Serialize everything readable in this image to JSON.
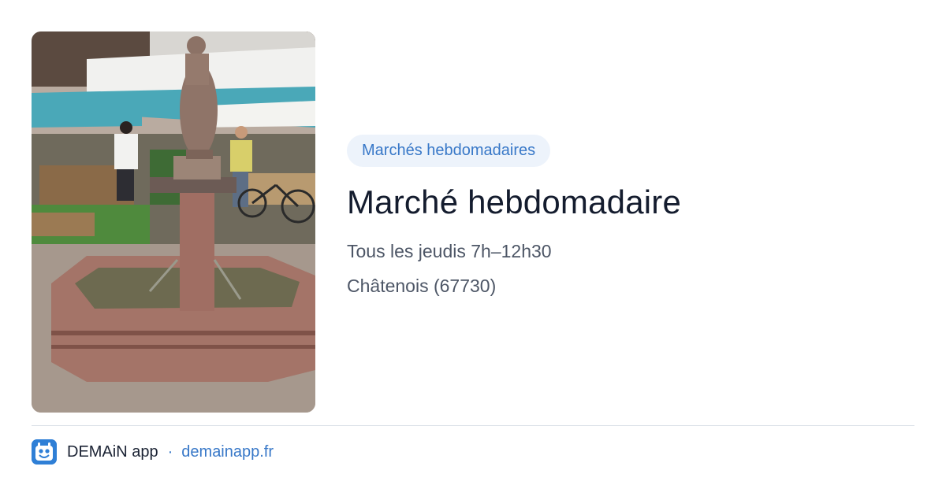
{
  "photo": {
    "description_icon": "market-fountain-photo",
    "awning_color": "#4aa8b8",
    "stone_color": "#9a6f66"
  },
  "event": {
    "category": "Marchés hebdomadaires",
    "title": "Marché hebdomadaire",
    "schedule": "Tous les jeudis 7h–12h30",
    "location": "Châtenois (67730)"
  },
  "footer": {
    "logo_icon": "demain-app-logo-icon",
    "brand": "DEMAiN app",
    "separator": "·",
    "domain": "demainapp.fr"
  },
  "colors": {
    "accent": "#3878c8",
    "tag_bg": "#edf3fb",
    "title": "#141c2e",
    "meta": "#4d5666"
  }
}
